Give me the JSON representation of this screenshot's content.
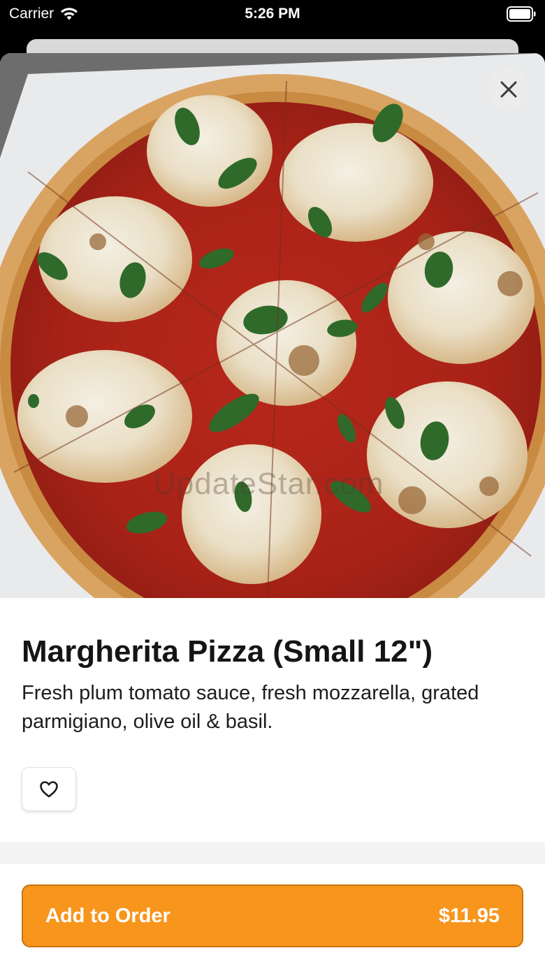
{
  "status_bar": {
    "carrier": "Carrier",
    "time": "5:26 PM"
  },
  "hero": {
    "watermark": "UpdateStar.com",
    "alt_subject": "pizza-photo"
  },
  "item": {
    "title": "Margherita Pizza (Small 12\")",
    "description": "Fresh plum tomato sauce, fresh mozzarella, grated parmigiano, olive oil & basil."
  },
  "order_button": {
    "label": "Add to Order",
    "price": "$11.95"
  },
  "icons": {
    "close": "close-icon",
    "favorite": "heart-icon",
    "wifi": "wifi-icon",
    "battery": "battery-icon"
  },
  "colors": {
    "accent": "#f7951d",
    "accent_border": "#c9720d"
  }
}
